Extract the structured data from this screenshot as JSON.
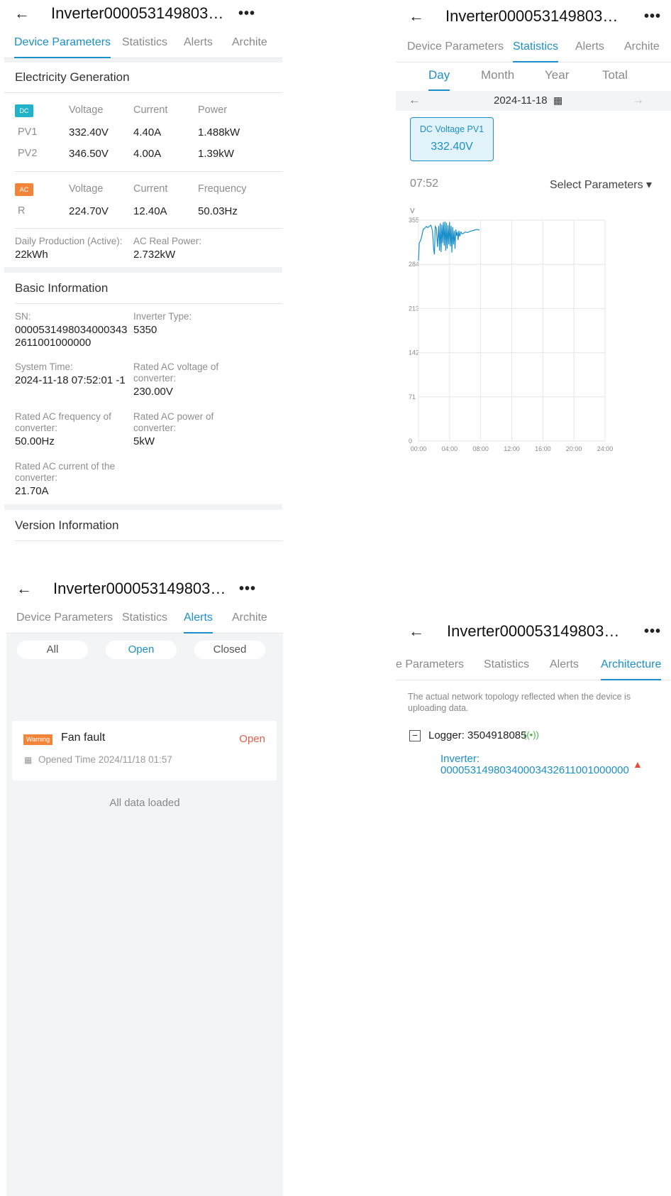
{
  "device": {
    "title": "Inverter00005314980340...",
    "more_label": "•••",
    "back_label": "←"
  },
  "tabs": {
    "device_parameters": "Device Parameters",
    "device_parameters_clipped": "e Parameters",
    "statistics": "Statistics",
    "alerts": "Alerts",
    "architecture": "Architecture",
    "architecture_clipped": "Archite"
  },
  "params": {
    "electricity_title": "Electricity Generation",
    "dc_badge": "DC",
    "ac_badge": "AC",
    "col_voltage": "Voltage",
    "col_current": "Current",
    "col_power": "Power",
    "col_frequency": "Frequency",
    "pv1": {
      "name": "PV1",
      "voltage": "332.40V",
      "current": "4.40A",
      "power": "1.488kW"
    },
    "pv2": {
      "name": "PV2",
      "voltage": "346.50V",
      "current": "4.00A",
      "power": "1.39kW"
    },
    "r": {
      "name": "R",
      "voltage": "224.70V",
      "current": "12.40A",
      "frequency": "50.03Hz"
    },
    "daily_label": "Daily Production (Active):",
    "daily_value": "22kWh",
    "ac_power_label": "AC Real Power:",
    "ac_power_value": "2.732kW",
    "basic_title": "Basic Information",
    "sn_label": "SN:",
    "sn_value_1": "0000531498034000343",
    "sn_value_2": "2611001000000",
    "inv_type_label": "Inverter Type:",
    "inv_type_value": "5350",
    "sys_time_label": "System Time:",
    "sys_time_value": "2024-11-18 07:52:01 -1",
    "rated_v_label_1": "Rated AC voltage of",
    "rated_v_label_2": "converter:",
    "rated_v_value": "230.00V",
    "rated_f_label_1": "Rated AC frequency of",
    "rated_f_label_2": "converter:",
    "rated_f_value": "50.00Hz",
    "rated_p_label_1": "Rated AC power of",
    "rated_p_label_2": "converter:",
    "rated_p_value": "5kW",
    "rated_c_label_1": "Rated AC current of the",
    "rated_c_label_2": "converter:",
    "rated_c_value": "21.70A",
    "version_title": "Version Information"
  },
  "stats": {
    "subtabs": {
      "day": "Day",
      "month": "Month",
      "year": "Year",
      "total": "Total"
    },
    "date": "2024-11-18",
    "prev_arrow": "←",
    "next_arrow": "→",
    "card_label": "DC Voltage PV1",
    "card_value": "332.40V",
    "time": "07:52",
    "select_params": "Select Parameters ▾",
    "unit": "V"
  },
  "chart_data": {
    "type": "line",
    "ylabel": "V",
    "yticks": [
      0,
      71,
      142,
      213,
      284,
      355
    ],
    "xticks": [
      "00:00",
      "04:00",
      "08:00",
      "12:00",
      "16:00",
      "20:00",
      "24:00"
    ],
    "xlim": [
      0,
      24
    ],
    "ylim": [
      0,
      355
    ],
    "grid": true,
    "color": "#1b8fc9",
    "series": [
      {
        "x": [
          0.0,
          0.1,
          0.25,
          0.4,
          0.6,
          0.8,
          1.0,
          1.2,
          1.4,
          1.6,
          1.8,
          1.95,
          2.05,
          2.15,
          2.3,
          2.45,
          2.6,
          2.7,
          2.8,
          2.9,
          3.0,
          3.1,
          3.2,
          3.3,
          3.4,
          3.5,
          3.6,
          3.7,
          3.8,
          3.9,
          4.0,
          4.1,
          4.2,
          4.3,
          4.4,
          4.5,
          4.6,
          4.7,
          4.8,
          4.9,
          5.0,
          5.1,
          5.2,
          5.3,
          5.45,
          5.6,
          5.8,
          6.0,
          6.3,
          6.6,
          6.9,
          7.2,
          7.5,
          7.87
        ],
        "values": [
          290,
          318,
          322,
          328,
          340,
          342,
          345,
          343,
          345,
          347,
          338,
          308,
          300,
          345,
          342,
          312,
          346,
          306,
          350,
          304,
          348,
          318,
          352,
          314,
          353,
          306,
          351,
          309,
          347,
          316,
          352,
          313,
          346,
          303,
          344,
          316,
          338,
          309,
          340,
          330,
          336,
          323,
          338,
          329,
          336,
          333,
          334,
          336,
          335,
          337,
          338,
          339,
          340,
          339
        ]
      }
    ]
  },
  "alerts": {
    "filters": {
      "all": "All",
      "open": "Open",
      "closed": "Closed"
    },
    "item": {
      "level": "Warning",
      "name": "Fan fault",
      "status": "Open",
      "opened": "Opened Time 2024/11/18 01:57"
    },
    "footer": "All data loaded"
  },
  "architecture": {
    "note_1": "The actual network topology reflected when the device is",
    "note_2": "uploading data.",
    "collapse_symbol": "−",
    "logger": "Logger: 3504918085",
    "inverter_label": "Inverter:",
    "inverter_sn": "00005314980340003432611001000000"
  },
  "colors": {
    "accent": "#1b8fc9",
    "warning": "#f2853a",
    "dc": "#21b3c9",
    "alert_red": "#e74c3c",
    "signal_green": "#3db83d"
  }
}
